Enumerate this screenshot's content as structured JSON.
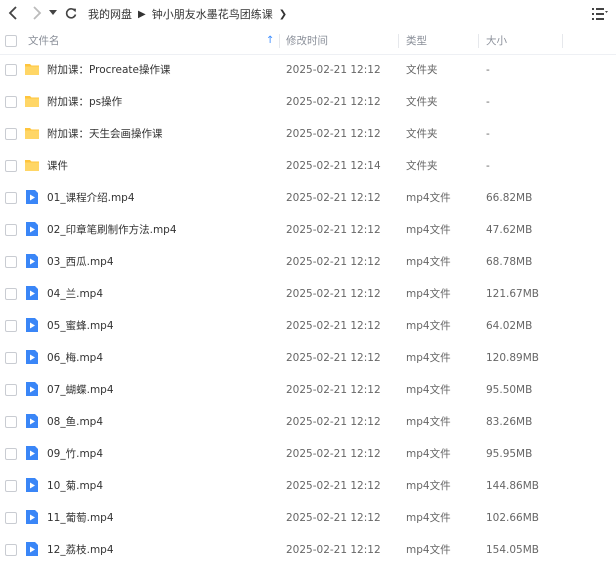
{
  "nav": {
    "back_icon": "chevron-left-icon",
    "forward_icon": "chevron-right-icon",
    "dropdown_icon": "caret-down-icon",
    "refresh_icon": "refresh-icon",
    "view_icon": "list-view-icon"
  },
  "breadcrumb": [
    "我的网盘",
    "钟小朋友水墨花鸟团练课"
  ],
  "columns": {
    "name": "文件名",
    "date": "修改时间",
    "type": "类型",
    "size": "大小"
  },
  "colors": {
    "folder": "#ffc53d",
    "video": "#3a86f7",
    "sort_arrow": "#3b8cff"
  },
  "files": [
    {
      "name": "附加课：Procreate操作课",
      "date": "2025-02-21 12:12",
      "type": "文件夹",
      "size": "-",
      "icon": "folder"
    },
    {
      "name": "附加课：ps操作",
      "date": "2025-02-21 12:12",
      "type": "文件夹",
      "size": "-",
      "icon": "folder"
    },
    {
      "name": "附加课：天生会画操作课",
      "date": "2025-02-21 12:12",
      "type": "文件夹",
      "size": "-",
      "icon": "folder"
    },
    {
      "name": "课件",
      "date": "2025-02-21 12:14",
      "type": "文件夹",
      "size": "-",
      "icon": "folder"
    },
    {
      "name": "01_课程介绍.mp4",
      "date": "2025-02-21 12:12",
      "type": "mp4文件",
      "size": "66.82MB",
      "icon": "video"
    },
    {
      "name": "02_印章笔刷制作方法.mp4",
      "date": "2025-02-21 12:12",
      "type": "mp4文件",
      "size": "47.62MB",
      "icon": "video"
    },
    {
      "name": "03_西瓜.mp4",
      "date": "2025-02-21 12:12",
      "type": "mp4文件",
      "size": "68.78MB",
      "icon": "video"
    },
    {
      "name": "04_兰.mp4",
      "date": "2025-02-21 12:12",
      "type": "mp4文件",
      "size": "121.67MB",
      "icon": "video"
    },
    {
      "name": "05_蜜蜂.mp4",
      "date": "2025-02-21 12:12",
      "type": "mp4文件",
      "size": "64.02MB",
      "icon": "video"
    },
    {
      "name": "06_梅.mp4",
      "date": "2025-02-21 12:12",
      "type": "mp4文件",
      "size": "120.89MB",
      "icon": "video"
    },
    {
      "name": "07_蝴蝶.mp4",
      "date": "2025-02-21 12:12",
      "type": "mp4文件",
      "size": "95.50MB",
      "icon": "video"
    },
    {
      "name": "08_鱼.mp4",
      "date": "2025-02-21 12:12",
      "type": "mp4文件",
      "size": "83.26MB",
      "icon": "video"
    },
    {
      "name": "09_竹.mp4",
      "date": "2025-02-21 12:12",
      "type": "mp4文件",
      "size": "95.95MB",
      "icon": "video"
    },
    {
      "name": "10_菊.mp4",
      "date": "2025-02-21 12:12",
      "type": "mp4文件",
      "size": "144.86MB",
      "icon": "video"
    },
    {
      "name": "11_葡萄.mp4",
      "date": "2025-02-21 12:12",
      "type": "mp4文件",
      "size": "102.66MB",
      "icon": "video"
    },
    {
      "name": "12_荔枝.mp4",
      "date": "2025-02-21 12:12",
      "type": "mp4文件",
      "size": "154.05MB",
      "icon": "video"
    }
  ]
}
